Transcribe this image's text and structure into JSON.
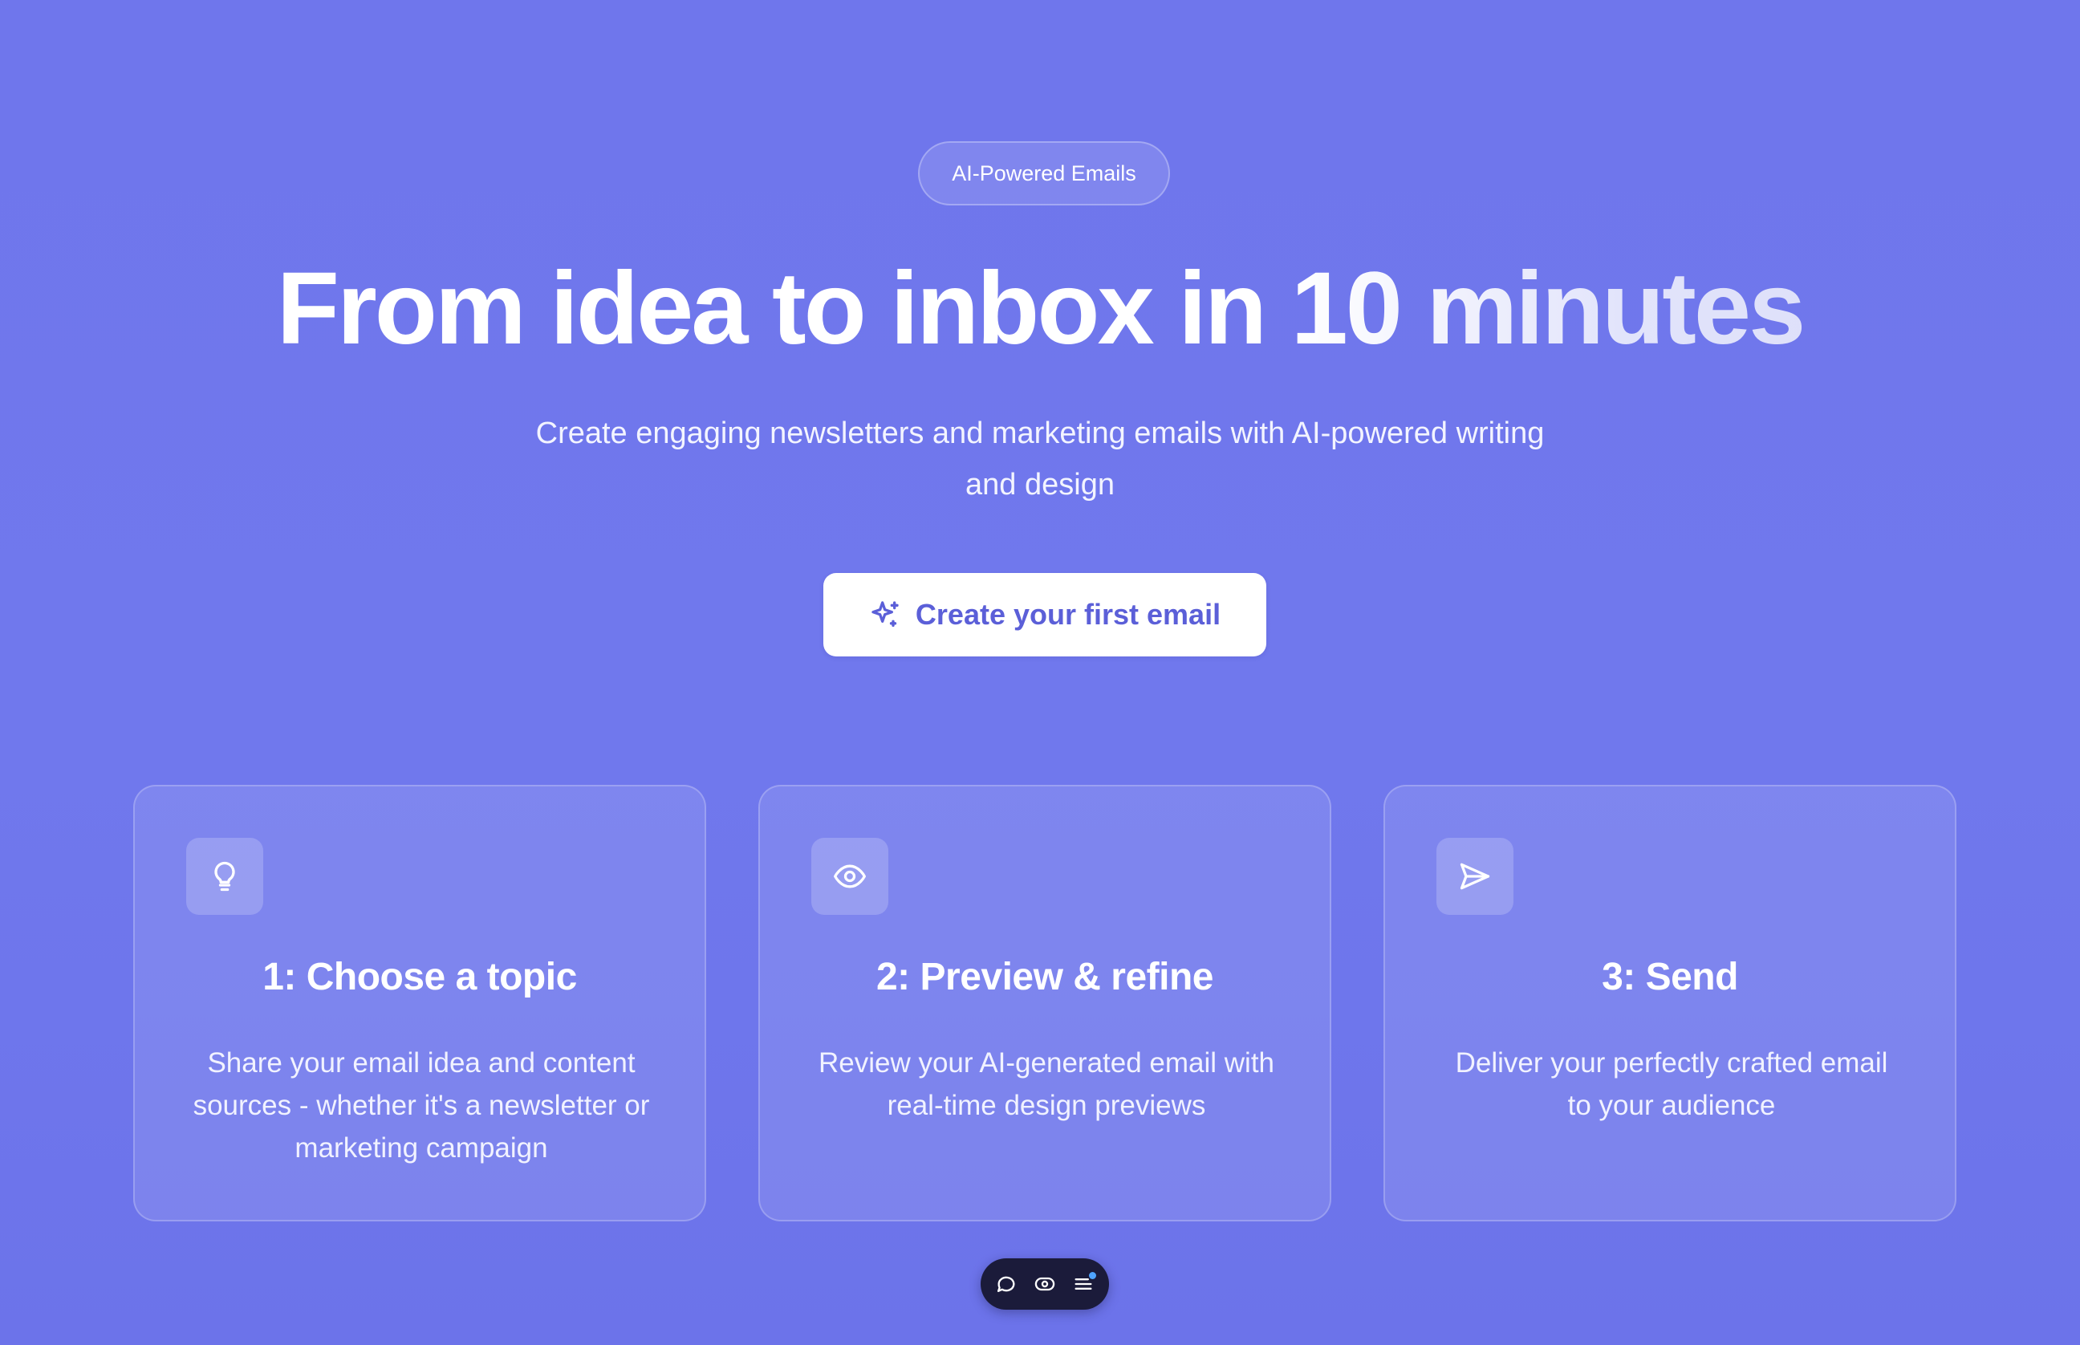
{
  "badge": "AI-Powered Emails",
  "headline": "From idea to inbox in 10 minutes",
  "subheadline": "Create engaging newsletters and marketing emails with AI-powered writing and design",
  "cta": {
    "label": "Create your first email",
    "icon": "sparkles-icon"
  },
  "steps": [
    {
      "icon": "lightbulb-icon",
      "title": "1: Choose a topic",
      "description": "Share your email idea and content sources - whether it's a newsletter or marketing campaign"
    },
    {
      "icon": "eye-icon",
      "title": "2: Preview & refine",
      "description": "Review your AI-generated email with real-time design previews"
    },
    {
      "icon": "send-icon",
      "title": "3: Send",
      "description": "Deliver your perfectly crafted email to your audience"
    }
  ],
  "toolbar": {
    "buttons": [
      "chat-bubble-icon",
      "eye-toggle-icon",
      "menu-lines-icon"
    ]
  },
  "colors": {
    "background": "#6f76ec",
    "cta_text": "#5b5fd8",
    "toolbar": "#1b1b3a",
    "notification_dot": "#4ea3ff"
  }
}
